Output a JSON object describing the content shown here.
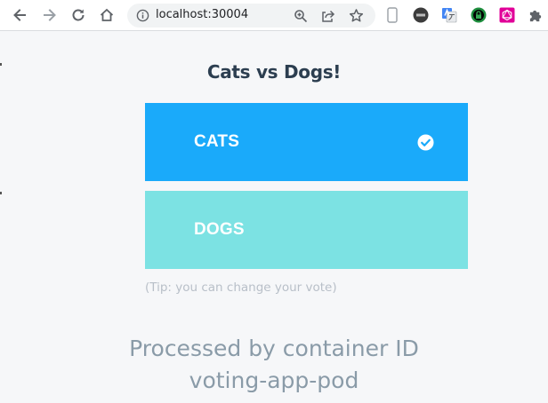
{
  "browser": {
    "url": "localhost:30004",
    "nav_icons": [
      "back-arrow-icon",
      "forward-arrow-icon",
      "reload-icon",
      "home-icon"
    ],
    "omnibox_icons": [
      "info-icon",
      "zoom-icon",
      "share-icon",
      "star-icon"
    ],
    "extension_icons": [
      "device-icon",
      "unix-extension-icon",
      "translate-extension-icon",
      "lock-extension-icon",
      "graphql-extension-icon",
      "puzzle-extensions-icon"
    ]
  },
  "page": {
    "title": "Cats vs Dogs!",
    "options": [
      {
        "label": "CATS",
        "selected": true,
        "color": "#1aaafa"
      },
      {
        "label": "DOGS",
        "selected": false,
        "color": "#7ce2e3"
      }
    ],
    "tip": "(Tip: you can change your vote)",
    "footer_line1": "Processed by container ID",
    "footer_line2": "voting-app-pod"
  },
  "colors": {
    "background": "#f6f7f9",
    "title": "#2c3e50",
    "footer": "#8a9ba8",
    "tip": "#b8bfc8"
  }
}
